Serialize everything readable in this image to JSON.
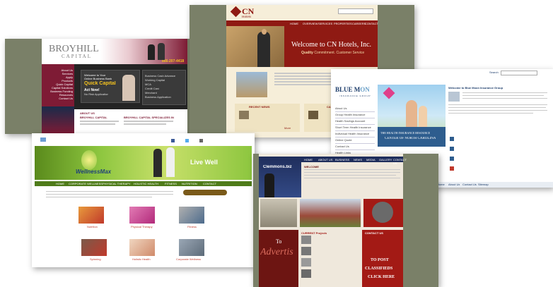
{
  "broyhill": {
    "logo_text": "BROYHILL",
    "logo_sub": "CAPITAL",
    "phone": "866-207-4418",
    "promo": [
      "Welcome to Your",
      "Online Business Bank",
      "Quick Capital",
      "Act Now!",
      "No Risk Application"
    ],
    "menu": [
      "About Us",
      "Services",
      "Apply",
      "Products",
      "Quick Capital",
      "Capital Solutions",
      "Business Funding",
      "Resources",
      "Contact Us"
    ],
    "side_list": [
      "Business Cash Advance",
      "Working Capital",
      "MCA",
      "Credit Card",
      "Merchant",
      "Business Application"
    ],
    "bottom_headings": [
      "ABOUT US",
      "BROYHILL CAPITAL",
      "BROYHILL CAPITAL SPECIALIZES IN"
    ],
    "colors": {
      "maroon": "#7e1b35",
      "dark": "#242424",
      "gold": "#f4c21e"
    }
  },
  "cn": {
    "logo": "CN",
    "logo_sub": "Hotels",
    "nav": [
      "HOME",
      "OVERVIEW",
      "SERVICES",
      "PROPERTIES",
      "CAREERS",
      "CONTACT"
    ],
    "hero_title": "Welcome to CN Hotels, Inc.",
    "hero_sub_bold": "Quality",
    "hero_sub": "Commitment. Customer Service",
    "sections": [
      "RECENT NEWS",
      "CAREERS"
    ],
    "more": "More",
    "colors": {
      "red": "#8f1a13",
      "cream": "#f6eed9",
      "gold": "#c89c3a"
    }
  },
  "bluemoon": {
    "logo_a": "BLUE M",
    "logo_b": "ON",
    "logo_sub": "INSURANCE GROUP",
    "welcome": "Welcome to Blue Moon Insurance Group",
    "side_menu": [
      "About Us",
      "Group Health Insurance",
      "Health Savings Account",
      "Short Term Health Insurance",
      "Individual Health Insurance",
      "Online Quote",
      "Contact Us",
      "Health Links"
    ],
    "banner_line1": "THE HEALTH INSURANCE RESOURCE",
    "banner_line2": "CENTER OF NORTH CAROLINA",
    "search": "Search",
    "footer_links": [
      "Home",
      "About Us",
      "Contact Us",
      "Sitemap"
    ],
    "colors": {
      "navy": "#1d3d6b",
      "sky": "#6aa0c8"
    }
  },
  "wellness": {
    "logo": "WellnessMax",
    "tagline": "Live Well",
    "nav": [
      "HOME",
      "CORPORATE WELLNESS",
      "PHYSICAL THERAPY",
      "HOLISTIC HEALTH",
      "FITNESS",
      "NUTRITION",
      "CONTACT"
    ],
    "tiles": [
      "Nutrition",
      "Physical Therapy",
      "Fitness",
      "Spinning",
      "Holistic Health",
      "Corporate Wellness"
    ],
    "colors": {
      "green": "#8dc63f",
      "dark_green": "#5a8a1c",
      "lime": "#c8e06a"
    }
  },
  "classifieds": {
    "logo": "Clemmons.biz",
    "nav": [
      "HOME",
      "ABOUT US",
      "BUSINESS",
      "NEWS",
      "MEDIA",
      "GALLERY",
      "CONTACT US"
    ],
    "welcome": "WELCOME",
    "ad_text": "Advertis",
    "ad_to": "To",
    "post_lines": [
      "TO POST",
      "CLASSIFIEDS",
      "CLICK HERE"
    ],
    "current_label": "CURRENT Projects",
    "contact": "CONTACT US",
    "colors": {
      "maroon": "#6d1512",
      "navy": "#1f2e5c",
      "red": "#a31a15"
    }
  }
}
